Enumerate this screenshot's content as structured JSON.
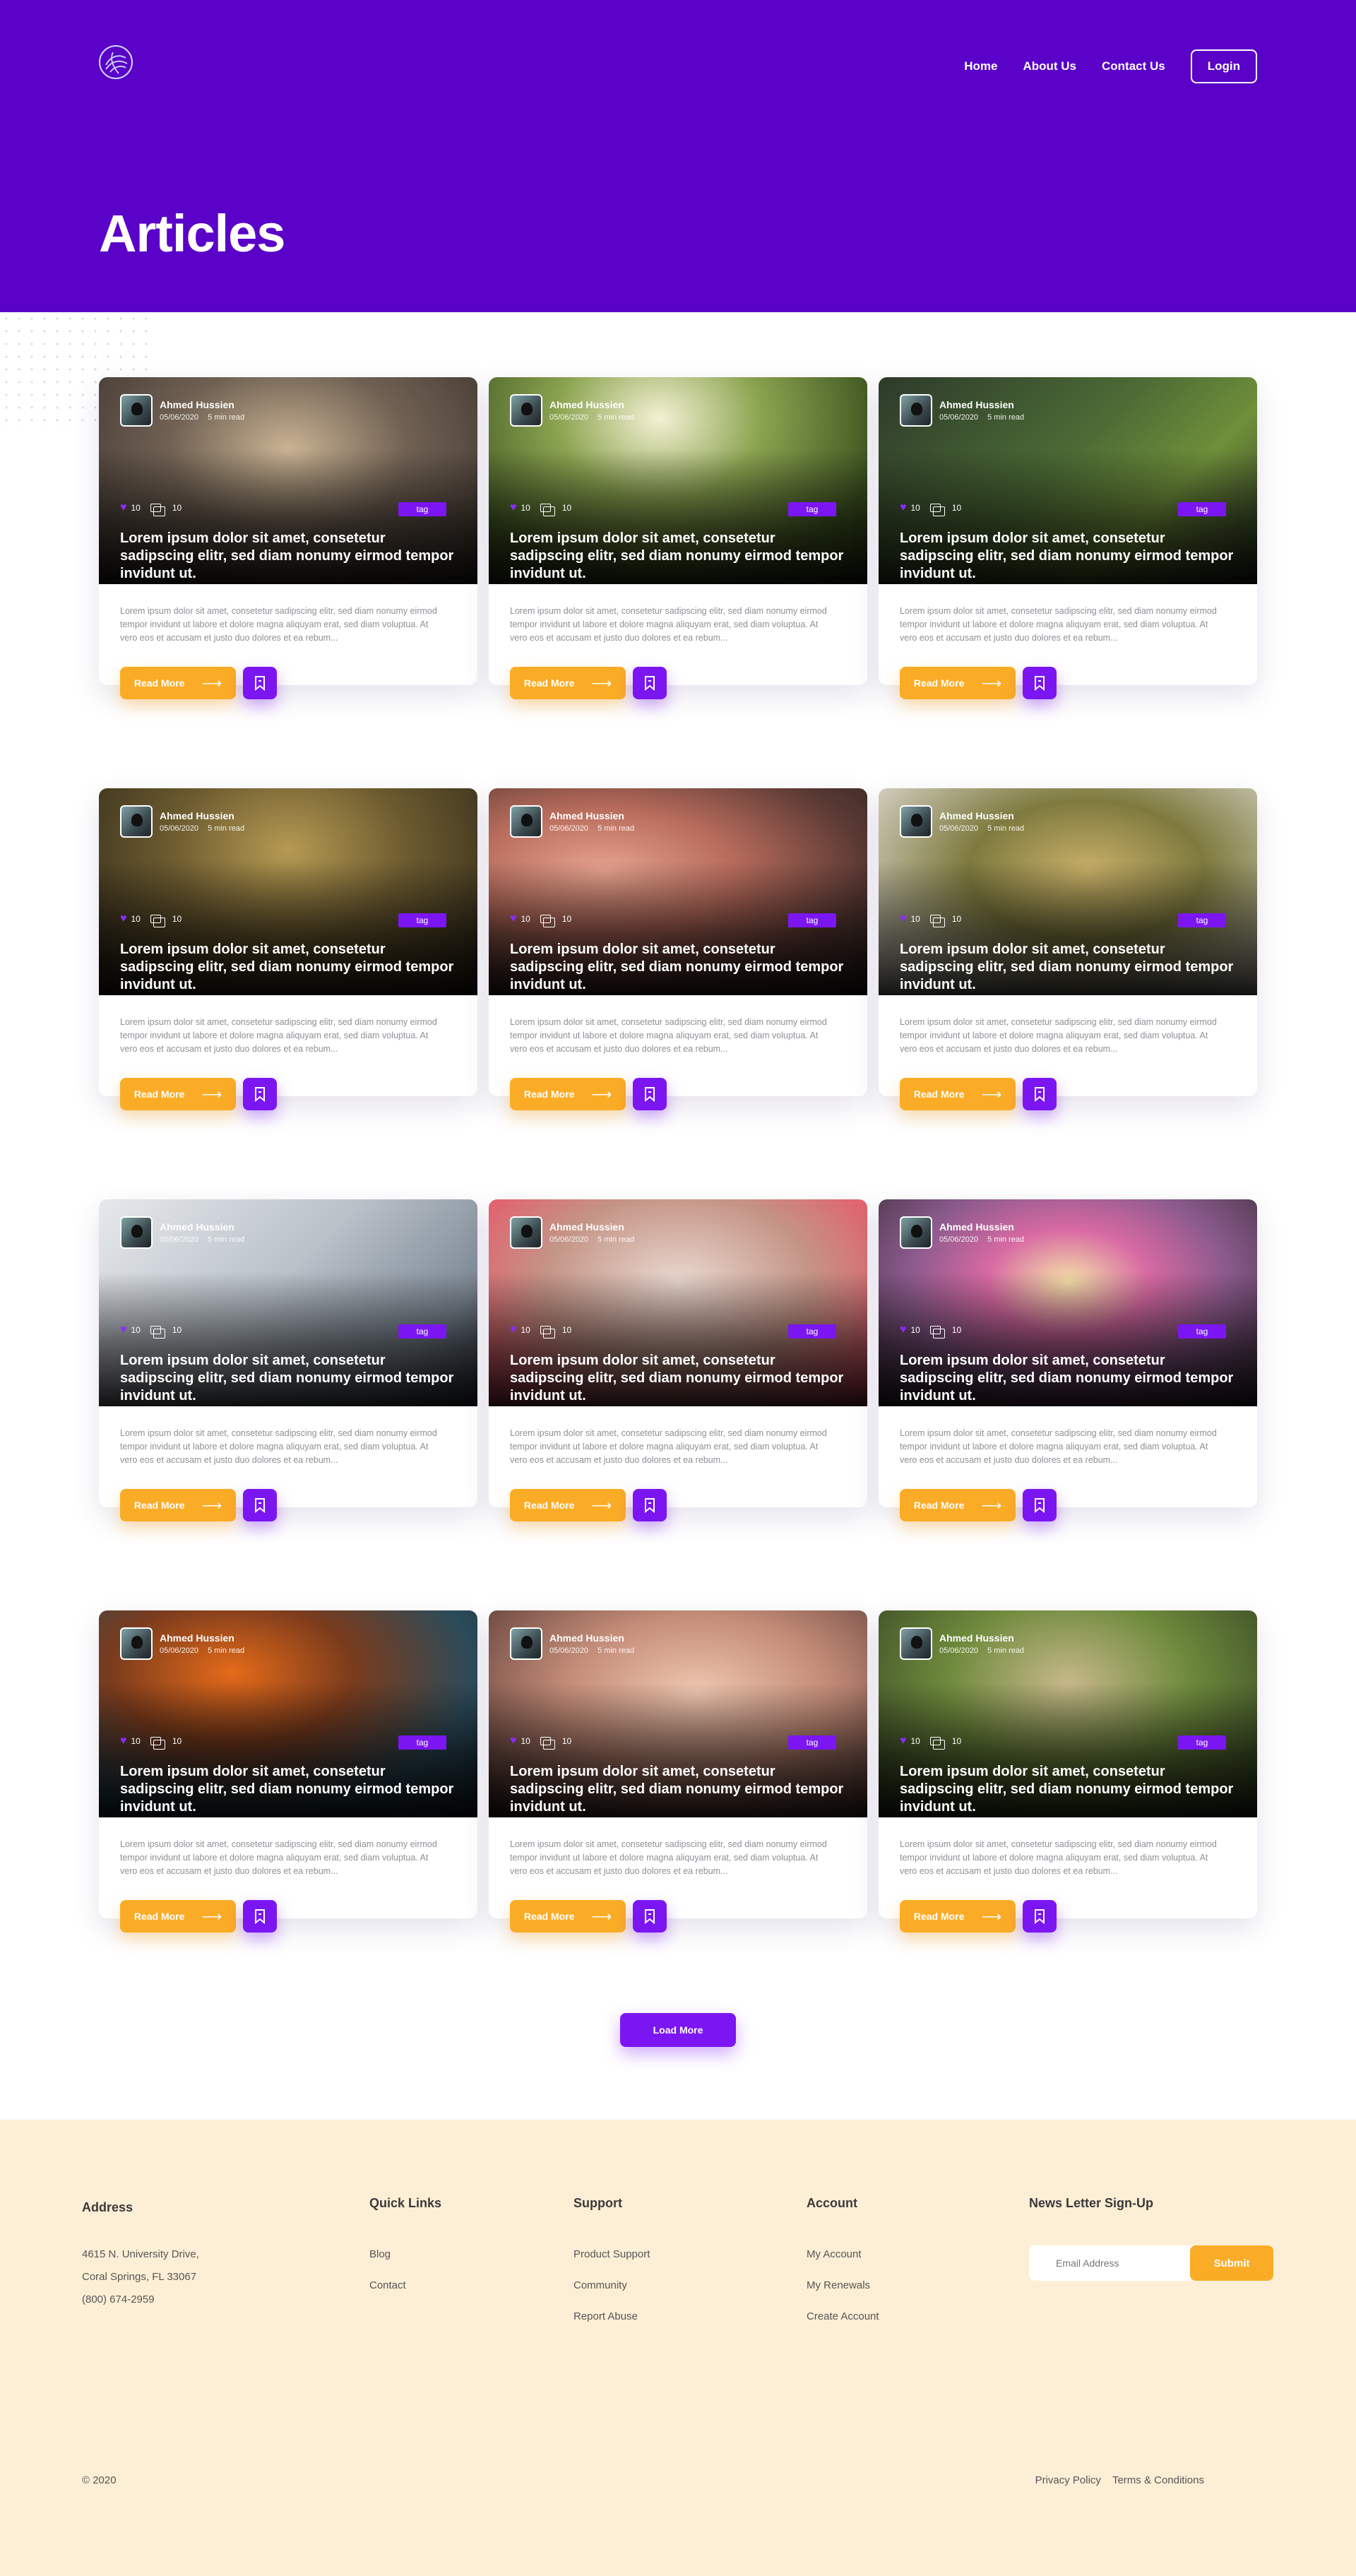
{
  "header": {
    "logo_icon": "globe-icon",
    "nav": [
      "Home",
      "About Us",
      "Contact Us"
    ],
    "login_label": "Login",
    "background_color": "#5a02c8"
  },
  "hero": {
    "title": "Articles"
  },
  "card_template": {
    "author": "Ahmed Hussien",
    "date": "05/06/2020",
    "read_time": "5 min read",
    "likes": "10",
    "comments": "10",
    "tag": "tag",
    "title": "Lorem ipsum dolor sit amet, consetetur sadipscing elitr, sed diam nonumy eirmod tempor invidunt ut.",
    "excerpt": "Lorem ipsum dolor sit amet, consetetur sadipscing elitr, sed diam nonumy eirmod tempor invidunt ut labore et dolore magna aliquyam erat, sed diam voluptua. At vero eos et accusam et justo duo dolores et ea rebum...",
    "read_more_label": "Read More"
  },
  "cards": [
    {
      "image": "man-in-hood-sunset-photo"
    },
    {
      "image": "woman-running-forest-road-photo"
    },
    {
      "image": "broccoli-banana-nuts-photo"
    },
    {
      "image": "two-runners-silhouette-photo"
    },
    {
      "image": "grapefruit-cherries-plate-photo"
    },
    {
      "image": "herbal-tea-glasses-photo"
    },
    {
      "image": "doctor-holding-pills-photo"
    },
    {
      "image": "feet-on-scale-photo"
    },
    {
      "image": "colorful-pills-photo"
    },
    {
      "image": "pill-bottle-spilling-photo"
    },
    {
      "image": "hand-holding-capsules-photo"
    },
    {
      "image": "man-meditating-photo"
    }
  ],
  "load_more_label": "Load More",
  "footer": {
    "address": {
      "heading": "Address",
      "lines": [
        "4615 N. University Drive,",
        "Coral Springs, FL 33067",
        "(800) 674-2959"
      ]
    },
    "quick_links": {
      "heading": "Quick Links",
      "items": [
        "Blog",
        "Contact"
      ]
    },
    "support": {
      "heading": "Support",
      "items": [
        "Product Support",
        "Community",
        "Report Abuse"
      ]
    },
    "account": {
      "heading": "Account",
      "items": [
        "My Account",
        "My Renewals",
        "Create Account"
      ]
    },
    "newsletter": {
      "heading": "News Letter Sign-Up",
      "placeholder": "Email Address",
      "submit_label": "Submit"
    },
    "copyright": "© 2020",
    "legal": [
      "Privacy Policy",
      "Terms & Conditions"
    ],
    "background_color": "#fdefd6"
  },
  "colors": {
    "accent_orange": "#fbac26",
    "accent_purple": "#7b16f2"
  }
}
